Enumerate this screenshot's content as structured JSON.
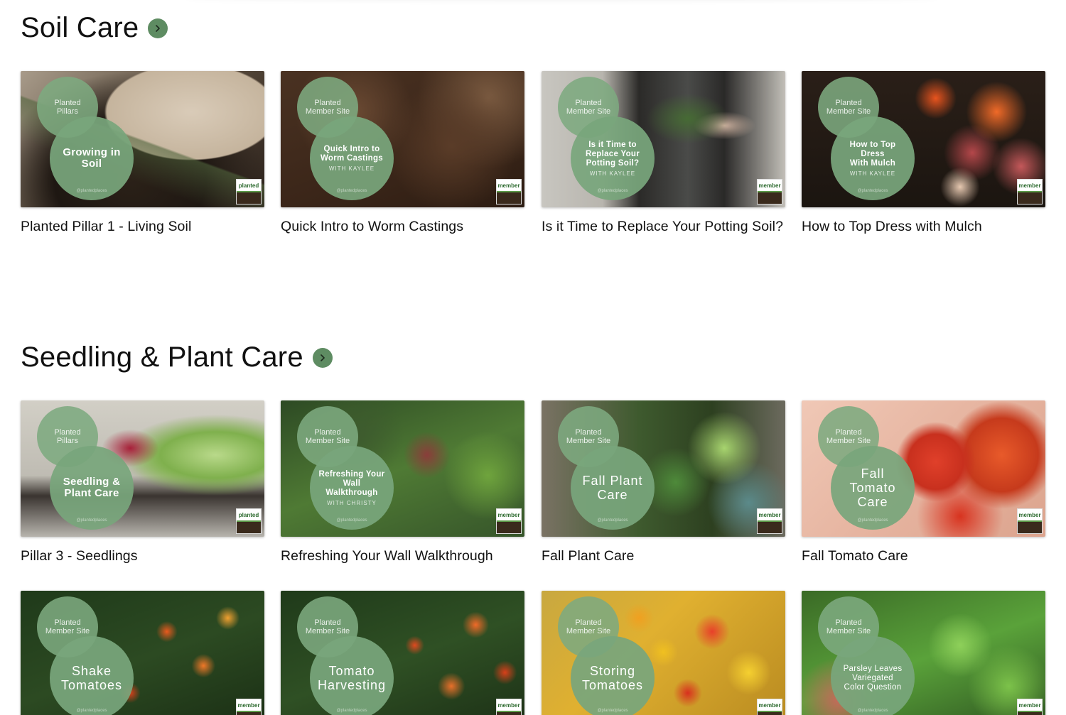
{
  "sections": [
    {
      "title": "Soil Care",
      "cards": [
        {
          "title": "Planted Pillar 1 - Living Soil",
          "badge": "Planted\nPillars",
          "overlay": "Growing in\nSoil",
          "overlay_sub": "",
          "handle": "@plantedplaces",
          "logo": "planted"
        },
        {
          "title": "Quick Intro to Worm Castings",
          "badge": "Planted\nMember Site",
          "overlay": "Quick Intro to\nWorm Castings",
          "overlay_sub": "WITH KAYLEE",
          "handle": "@plantedplaces",
          "logo": "member"
        },
        {
          "title": "Is it Time to Replace Your Potting Soil?",
          "badge": "Planted\nMember Site",
          "overlay": "Is it Time to\nReplace Your\nPotting Soil?",
          "overlay_sub": "WITH KAYLEE",
          "handle": "@plantedplaces",
          "logo": "member"
        },
        {
          "title": "How to Top Dress with Mulch",
          "badge": "Planted\nMember Site",
          "overlay": "How to Top Dress\nWith Mulch",
          "overlay_sub": "WITH KAYLEE",
          "handle": "@plantedplaces",
          "logo": "member"
        }
      ]
    },
    {
      "title": "Seedling & Plant Care",
      "cards": [
        {
          "title": "Pillar 3 - Seedlings",
          "badge": "Planted\nPillars",
          "overlay": "Seedling &\nPlant Care",
          "overlay_sub": "",
          "handle": "@plantedplaces",
          "logo": "planted"
        },
        {
          "title": "Refreshing Your Wall Walkthrough",
          "badge": "Planted\nMember Site",
          "overlay": "Refreshing Your\nWall Walkthrough",
          "overlay_sub": "WITH CHRISTY",
          "handle": "@plantedplaces",
          "logo": "member"
        },
        {
          "title": "Fall Plant Care",
          "badge": "Planted\nMember Site",
          "overlay": "Fall Plant\nCare",
          "overlay_sub": "",
          "handle": "@plantedplaces",
          "logo": "member"
        },
        {
          "title": "Fall Tomato Care",
          "badge": "Planted\nMember Site",
          "overlay": "Fall\nTomato\nCare",
          "overlay_sub": "",
          "handle": "@plantedplaces",
          "logo": "member"
        },
        {
          "title": "",
          "badge": "Planted\nMember Site",
          "overlay": "Shake\nTomatoes",
          "overlay_sub": "",
          "handle": "@plantedplaces",
          "logo": "member"
        },
        {
          "title": "",
          "badge": "Planted\nMember Site",
          "overlay": "Tomato\nHarvesting",
          "overlay_sub": "",
          "handle": "@plantedplaces",
          "logo": "member"
        },
        {
          "title": "",
          "badge": "Planted\nMember Site",
          "overlay": "Storing\nTomatoes",
          "overlay_sub": "",
          "handle": "@plantedplaces",
          "logo": "member"
        },
        {
          "title": "",
          "badge": "Planted\nMember Site",
          "overlay": "Parsley Leaves\nVariegated\nColor Question",
          "overlay_sub": "",
          "handle": "@plantedplaces",
          "logo": "member"
        }
      ]
    }
  ],
  "icons": {
    "section_arrow": "chevron-right-icon"
  },
  "colors": {
    "accent": "#5e8c62",
    "overlay": "#78a67c"
  }
}
